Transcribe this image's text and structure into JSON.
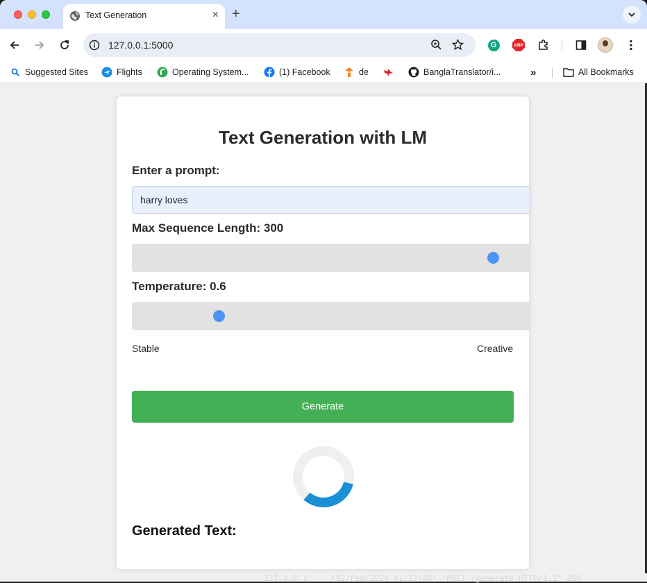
{
  "browser": {
    "tab": {
      "title": "Text Generation",
      "favicon": "globe-icon",
      "close": "×"
    },
    "new_tab": "+",
    "address": {
      "url": "127.0.0.1:5000"
    },
    "bookmarks": [
      {
        "label": "Suggested Sites",
        "icon": "search-icon"
      },
      {
        "label": "Flights",
        "icon": "flights-icon"
      },
      {
        "label": "Operating System...",
        "icon": "os-icon"
      },
      {
        "label": "(1) Facebook",
        "icon": "facebook-icon"
      },
      {
        "label": "de",
        "icon": "huggingface-icon"
      },
      {
        "label": "",
        "icon": "bird-icon"
      },
      {
        "label": "BanglaTranslator/i...",
        "icon": "github-icon"
      }
    ],
    "overflow": "»",
    "all_bookmarks": "All Bookmarks"
  },
  "app": {
    "title": "Text Generation with LM",
    "prompt_label": "Enter a prompt:",
    "prompt_value": "harry loves",
    "max_len_label": "Max Sequence Length: 300",
    "max_len": {
      "value": 300,
      "fraction": 0.96
    },
    "temp_label": "Temperature: 0.6",
    "temp": {
      "value": 0.6,
      "fraction": 0.22
    },
    "scale_left": "Stable",
    "scale_right": "Creative",
    "generate_label": "Generate",
    "output_title": "Generated Text:"
  },
  "terminal": {
    "line": "127.0.0.1 - - [02/Feb/2024 01:17:46] \"POST /generate HTTP/1.1\" 200 -"
  },
  "colors": {
    "accent_green": "#44b055",
    "slider_thumb": "#4b94f7",
    "spinner_blue": "#1a8fd6"
  }
}
